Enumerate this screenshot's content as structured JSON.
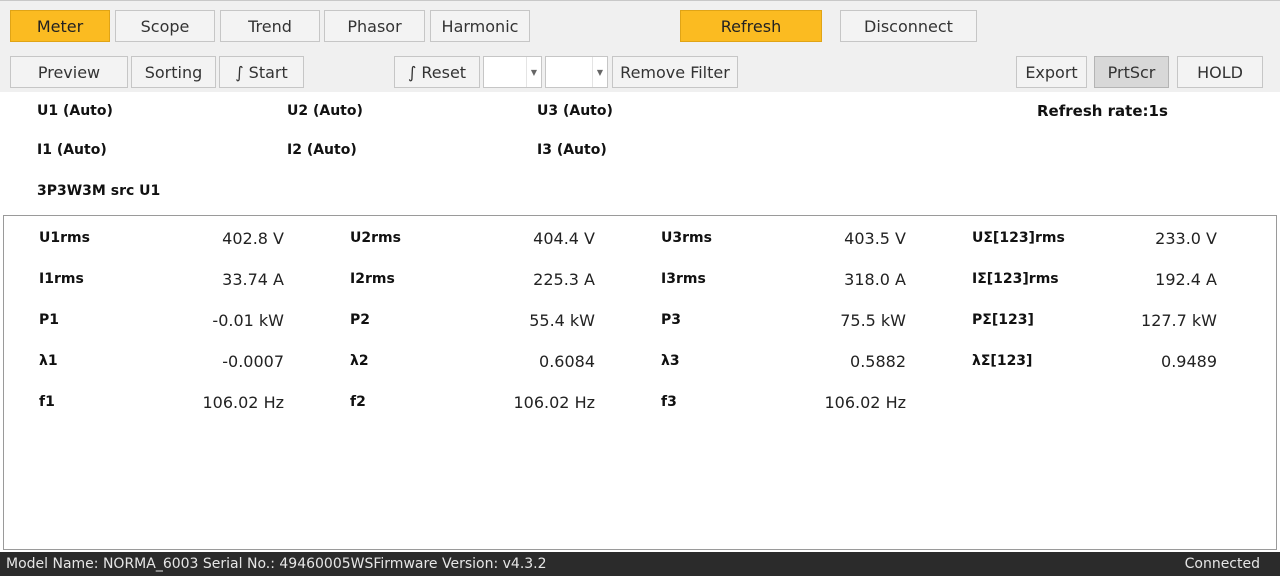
{
  "tabs": [
    {
      "label": "Meter",
      "active": true
    },
    {
      "label": "Scope",
      "active": false
    },
    {
      "label": "Trend",
      "active": false
    },
    {
      "label": "Phasor",
      "active": false
    },
    {
      "label": "Harmonic",
      "active": false
    }
  ],
  "top_actions": {
    "refresh": "Refresh",
    "disconnect": "Disconnect"
  },
  "toolbar2": {
    "preview": "Preview",
    "sorting": "Sorting",
    "start": "∫ Start",
    "reset": "∫ Reset",
    "combo1": "",
    "combo2": "",
    "remove_filter": "Remove Filter",
    "export": "Export",
    "prtscr": "PrtScr",
    "hold": "HOLD"
  },
  "ranges": {
    "u1": "U1 (Auto)",
    "u2": "U2 (Auto)",
    "u3": "U3 (Auto)",
    "i1": "I1 (Auto)",
    "i2": "I2 (Auto)",
    "i3": "I3 (Auto)",
    "wiring": "3P3W3M src U1",
    "refresh_rate": "Refresh rate:1s"
  },
  "measurements": {
    "rows": [
      [
        {
          "name": "U1rms",
          "value": "402.8 V"
        },
        {
          "name": "U2rms",
          "value": "404.4 V"
        },
        {
          "name": "U3rms",
          "value": "403.5 V"
        },
        {
          "name": "UΣ[123]rms",
          "value": "233.0 V"
        }
      ],
      [
        {
          "name": "I1rms",
          "value": "33.74 A"
        },
        {
          "name": "I2rms",
          "value": "225.3 A"
        },
        {
          "name": "I3rms",
          "value": "318.0 A"
        },
        {
          "name": "IΣ[123]rms",
          "value": "192.4 A"
        }
      ],
      [
        {
          "name": "P1",
          "value": "-0.01 kW"
        },
        {
          "name": "P2",
          "value": "55.4 kW"
        },
        {
          "name": "P3",
          "value": "75.5 kW"
        },
        {
          "name": "PΣ[123]",
          "value": "127.7 kW"
        }
      ],
      [
        {
          "name": "λ1",
          "value": "-0.0007"
        },
        {
          "name": "λ2",
          "value": "0.6084"
        },
        {
          "name": "λ3",
          "value": "0.5882"
        },
        {
          "name": "λΣ[123]",
          "value": "0.9489"
        }
      ],
      [
        {
          "name": "f1",
          "value": "106.02 Hz"
        },
        {
          "name": "f2",
          "value": "106.02 Hz"
        },
        {
          "name": "f3",
          "value": "106.02 Hz"
        }
      ]
    ]
  },
  "status": {
    "info": "Model Name:  NORMA_6003 Serial No.:  49460005WSFirmware Version:  v4.3.2",
    "connection": "Connected"
  },
  "colors": {
    "accent": "#fbbb21",
    "status_bar": "#2b2b2b"
  }
}
